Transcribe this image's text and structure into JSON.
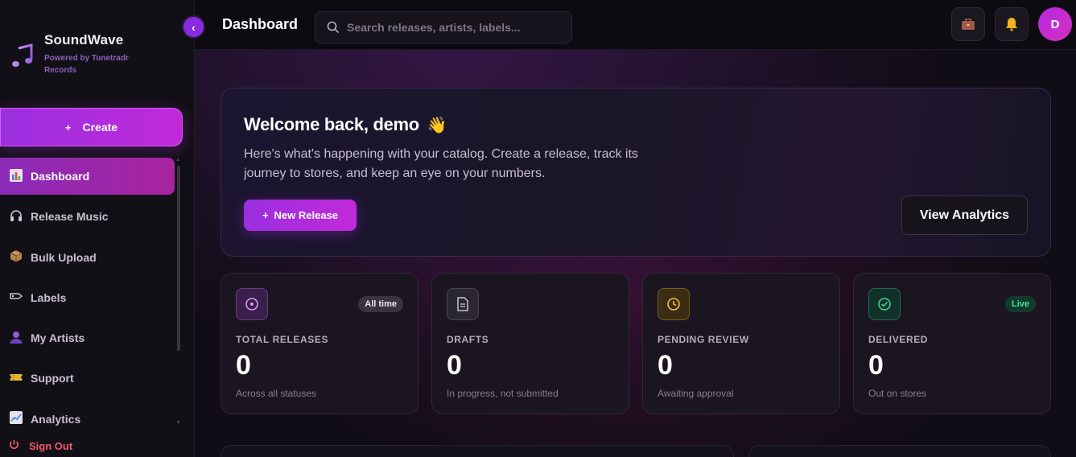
{
  "brand": {
    "name": "SoundWave",
    "subtitle": "Powered by Tunetradr Records",
    "logo_icon": "music-note-icon",
    "accent": "#a22fe0"
  },
  "sidebar": {
    "create_label": "Create",
    "items": [
      {
        "label": "Dashboard",
        "icon": "chart-icon",
        "active": true
      },
      {
        "label": "Release Music",
        "icon": "headphones-icon",
        "active": false
      },
      {
        "label": "Bulk Upload",
        "icon": "package-icon",
        "active": false
      },
      {
        "label": "Labels",
        "icon": "tag-icon",
        "active": false
      },
      {
        "label": "My Artists",
        "icon": "person-icon",
        "active": false
      },
      {
        "label": "Support",
        "icon": "ticket-icon",
        "active": false
      },
      {
        "label": "Analytics",
        "icon": "trend-icon",
        "active": false
      }
    ],
    "signout_label": "Sign Out",
    "signout_color": "#f05a6e"
  },
  "header": {
    "title": "Dashboard",
    "search_placeholder": "Search releases, artists, labels...",
    "avatar_initial": "D"
  },
  "welcome": {
    "title": "Welcome back, demo",
    "emoji": "👋",
    "description": "Here's what's happening with your catalog. Create a release, track its journey to stores, and keep an eye on your numbers.",
    "new_release_label": "New Release",
    "view_analytics_label": "View Analytics"
  },
  "stats": [
    {
      "label": "TOTAL RELEASES",
      "value": "0",
      "sub": "Across all statuses",
      "badge": "All time",
      "icon": "disc-icon",
      "color": "#c069f0"
    },
    {
      "label": "DRAFTS",
      "value": "0",
      "sub": "In progress, not submitted",
      "badge": "",
      "icon": "document-icon",
      "color": "#b8b3c2"
    },
    {
      "label": "PENDING REVIEW",
      "value": "0",
      "sub": "Awaiting approval",
      "badge": "",
      "icon": "clock-icon",
      "color": "#e8b431"
    },
    {
      "label": "DELIVERED",
      "value": "0",
      "sub": "Out on stores",
      "badge": "Live",
      "icon": "check-circle-icon",
      "color": "#3fd18f"
    }
  ]
}
